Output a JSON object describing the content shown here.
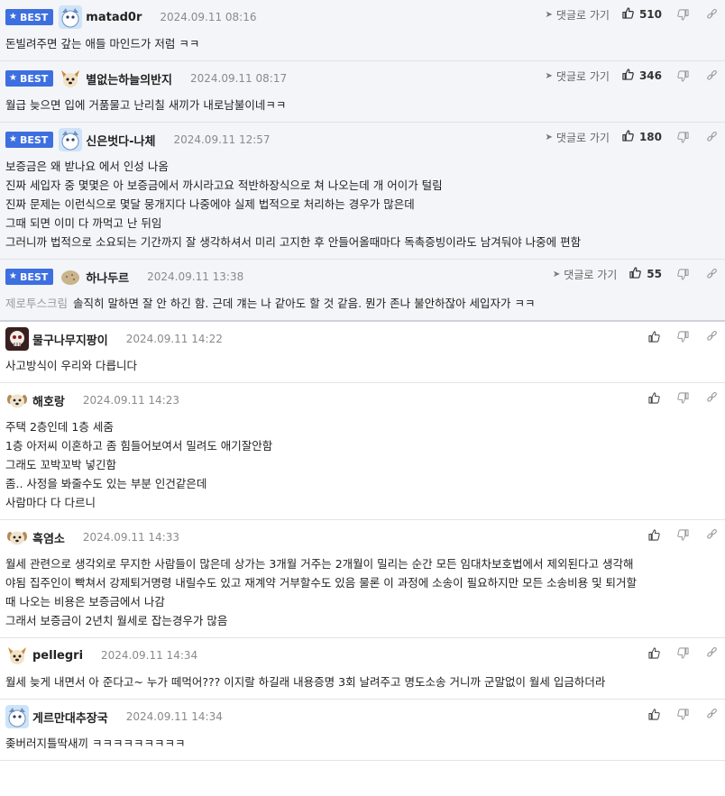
{
  "best_label": "BEST",
  "goto_label": "댓글로 가기",
  "comments": [
    {
      "best": true,
      "avatar": "blue-creature-avatar",
      "nick": "matad0r",
      "date": "2024.09.11 08:16",
      "likes": "510",
      "lines": [
        "돈빌려주면 갚는 애들 마인드가 저럼 ㅋㅋ"
      ]
    },
    {
      "best": true,
      "avatar": "dog-avatar",
      "nick": "별없는하늘의반지",
      "date": "2024.09.11 08:17",
      "likes": "346",
      "lines": [
        "월급 늦으면 입에 거품물고 난리칠 새끼가 내로남불이네ㅋㅋ"
      ]
    },
    {
      "best": true,
      "avatar": "blue-creature-avatar",
      "nick": "신은벗다-나체",
      "date": "2024.09.11 12:57",
      "likes": "180",
      "lines": [
        "보증금은 왜 받나요 에서 인성 나옴",
        "진짜 세입자 중 몇몇은 아 보증금에서 까시라고요 적반하장식으로 쳐 나오는데 개 어이가 털림",
        "진짜 문제는 이런식으로 몇달 뭉개지다 나중에야 실제 법적으로 처리하는 경우가 많은데",
        "그때 되면 이미 다 까먹고 난 뒤임",
        "그러니까 법적으로 소요되는 기간까지 잘 생각하셔서 미리 고지한 후 안들어올때마다 독촉증빙이라도 남겨둬야 나중에 편함"
      ]
    },
    {
      "best": true,
      "avatar": "potato-avatar",
      "nick": "하나두르",
      "date": "2024.09.11 13:38",
      "likes": "55",
      "reply_to": "제로투스크림",
      "lines": [
        "솔직히 말하면 잘 안 하긴 함. 근데 걔는 나 같아도 할 것 같음. 뭔가 존나 불안하잖아 세입자가 ㅋㅋ"
      ]
    },
    {
      "best": false,
      "avatar": "skull-avatar",
      "nick": "물구나무지팡이",
      "date": "2024.09.11 14:22",
      "lines": [
        "사고방식이 우리와 다릅니다"
      ]
    },
    {
      "best": false,
      "avatar": "puppy-avatar",
      "nick": "해호랑",
      "date": "2024.09.11 14:23",
      "lines": [
        "주택 2층인데 1층 세줌",
        "1층 아저씨 이혼하고 좀 힘들어보여서 밀려도 애기잘안함",
        "그래도 꼬박꼬박 넣긴함",
        "좀.. 사정을 봐줄수도 있는 부분 인건같은데",
        "사람마다 다 다르니"
      ]
    },
    {
      "best": false,
      "avatar": "puppy-avatar",
      "nick": "흑염소",
      "date": "2024.09.11 14:33",
      "lines": [
        "월세 관련으로 생각외로 무지한 사람들이 많은데 상가는 3개월 거주는 2개월이 밀리는 순간 모든 임대차보호법에서 제외된다고 생각해",
        "야됨 집주인이 빡쳐서 강제퇴거명령 내릴수도 있고 재계약 거부할수도 있음 물론 이 과정에 소송이 필요하지만 모든 소송비용 및 퇴거할",
        "때 나오는 비용은 보증금에서 나감",
        "그래서 보증금이 2년치 월세로 잡는경우가 많음"
      ]
    },
    {
      "best": false,
      "avatar": "dog-avatar",
      "nick": "pellegri",
      "date": "2024.09.11 14:34",
      "lines": [
        "월세 늦게 내면서 아 준다고~ 누가 떼먹어??? 이지랄 하길래 내용증명 3회 날려주고 명도소송 거니까 군말없이 월세 입금하더라"
      ]
    },
    {
      "best": false,
      "avatar": "blue-creature-avatar",
      "nick": "게르만대추장국",
      "date": "2024.09.11 14:34",
      "lines": [
        "좆버러지틀딱새끼 ㅋㅋㅋㅋㅋㅋㅋㅋㅋ"
      ]
    }
  ]
}
